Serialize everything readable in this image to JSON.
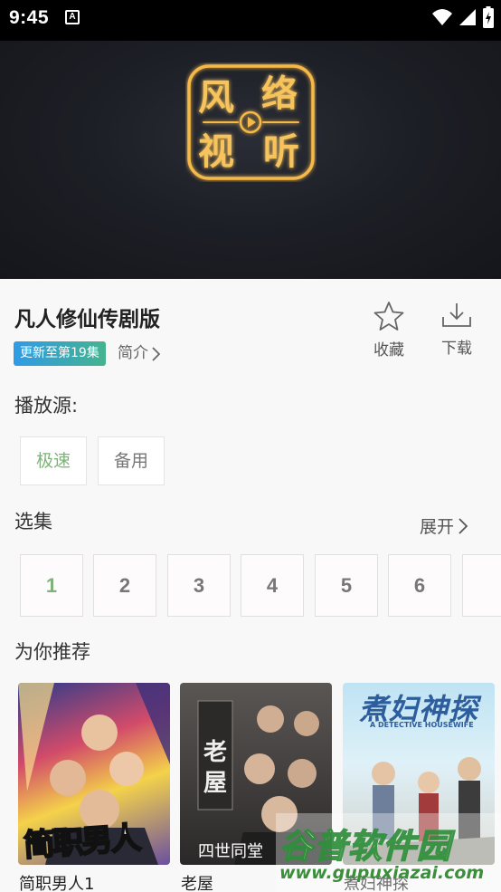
{
  "status_bar": {
    "time": "9:45",
    "notification_icon": "A"
  },
  "video": {
    "logo_text": [
      "风",
      "络",
      "视",
      "听"
    ]
  },
  "drama": {
    "title": "凡人修仙传剧版",
    "update_badge": "更新至第19集",
    "intro_label": "简介"
  },
  "actions": {
    "favorite_label": "收藏",
    "download_label": "下载"
  },
  "sources": {
    "heading": "播放源:",
    "items": [
      {
        "label": "极速",
        "selected": true
      },
      {
        "label": "备用",
        "selected": false
      }
    ]
  },
  "episodes": {
    "heading": "选集",
    "expand_label": "展开",
    "items": [
      "1",
      "2",
      "3",
      "4",
      "5",
      "6"
    ],
    "selected": "1"
  },
  "recommend": {
    "heading": "为你推荐",
    "items": [
      {
        "title": "简职男人1",
        "poster_text": "简职男人"
      },
      {
        "title": "老屋",
        "poster_text": "老屋",
        "poster_caption": "四世同堂"
      },
      {
        "title": "煮妇神探",
        "poster_text": "煮妇神探",
        "poster_subtext": "A DETECTIVE HOUSEWIFE"
      }
    ]
  },
  "watermark": {
    "name": "谷普软件园",
    "url": "www.gupuxiazai.com"
  },
  "colors": {
    "accent_green": "#7fb27a",
    "badge_blue": "#2f9be6",
    "badge_green": "#45b38f"
  }
}
